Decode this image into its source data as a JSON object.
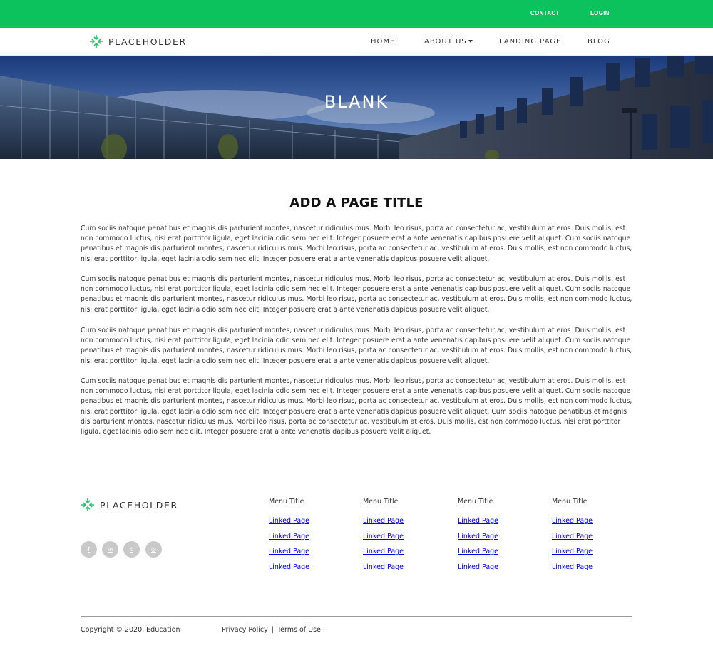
{
  "topbar": {
    "contact_label": "CONTACT",
    "login_label": "LOGIN",
    "background_color": "#0cc25c"
  },
  "header": {
    "logo_text": "PLACEHOLDER",
    "nav": {
      "home": "HOME",
      "about": "ABOUT US",
      "landing": "LANDING PAGE",
      "blog": "BLOG"
    }
  },
  "hero": {
    "title": "BLANK"
  },
  "main": {
    "page_title": "ADD A PAGE TITLE",
    "paragraphs": [
      "Cum sociis natoque penatibus et magnis dis parturient montes, nascetur ridiculus mus. Morbi leo risus, porta ac consectetur ac, vestibulum at eros. Duis mollis, est non commodo luctus, nisi erat porttitor ligula, eget lacinia odio sem nec elit. Integer posuere erat a ante venenatis dapibus posuere velit aliquet. Cum sociis natoque penatibus et magnis dis parturient montes, nascetur ridiculus mus. Morbi leo risus, porta ac consectetur ac, vestibulum at eros. Duis mollis, est non commodo luctus, nisi erat porttitor ligula, eget lacinia odio sem nec elit. Integer posuere erat a ante venenatis dapibus posuere velit aliquet.",
      "Cum sociis natoque penatibus et magnis dis parturient montes, nascetur ridiculus mus. Morbi leo risus, porta ac consectetur ac, vestibulum at eros. Duis mollis, est non commodo luctus, nisi erat porttitor ligula, eget lacinia odio sem nec elit. Integer posuere erat a ante venenatis dapibus posuere velit aliquet. Cum sociis natoque penatibus et magnis dis parturient montes, nascetur ridiculus mus. Morbi leo risus, porta ac consectetur ac, vestibulum at eros. Duis mollis, est non commodo luctus, nisi erat porttitor ligula, eget lacinia odio sem nec elit. Integer posuere erat a ante venenatis dapibus posuere velit aliquet.",
      "Cum sociis natoque penatibus et magnis dis parturient montes, nascetur ridiculus mus. Morbi leo risus, porta ac consectetur ac, vestibulum at eros. Duis mollis, est non commodo luctus, nisi erat porttitor ligula, eget lacinia odio sem nec elit. Integer posuere erat a ante venenatis dapibus posuere velit aliquet. Cum sociis natoque penatibus et magnis dis parturient montes, nascetur ridiculus mus. Morbi leo risus, porta ac consectetur ac, vestibulum at eros. Duis mollis, est non commodo luctus, nisi erat porttitor ligula, eget lacinia odio sem nec elit. Integer posuere erat a ante venenatis dapibus posuere velit aliquet.",
      "Cum sociis natoque penatibus et magnis dis parturient montes, nascetur ridiculus mus. Morbi leo risus, porta ac consectetur ac, vestibulum at eros. Duis mollis, est non commodo luctus, nisi erat porttitor ligula, eget lacinia odio sem nec elit. Integer posuere erat a ante venenatis dapibus posuere velit aliquet. Cum sociis natoque penatibus et magnis dis parturient montes, nascetur ridiculus mus. Morbi leo risus, porta ac consectetur ac, vestibulum at eros. Duis mollis, est non commodo luctus, nisi erat porttitor ligula, eget lacinia odio sem nec elit. Integer posuere erat a ante venenatis dapibus posuere velit aliquet. Cum sociis natoque penatibus et magnis dis parturient montes, nascetur ridiculus mus. Morbi leo risus, porta ac consectetur ac, vestibulum at eros. Duis mollis, est non commodo luctus, nisi erat porttitor ligula, eget lacinia odio sem nec elit. Integer posuere erat a ante venenatis dapibus posuere velit aliquet."
    ]
  },
  "footer": {
    "logo_text": "PLACEHOLDER",
    "social": [
      {
        "icon": "facebook-icon",
        "glyph": "f"
      },
      {
        "icon": "linkedin-icon",
        "glyph": "in"
      },
      {
        "icon": "twitter-icon",
        "glyph": "t"
      },
      {
        "icon": "instagram-icon",
        "glyph": "◎"
      }
    ],
    "columns": [
      {
        "title": "Menu Title",
        "links": [
          "Linked Page",
          "Linked Page",
          "Linked Page",
          "Linked Page"
        ]
      },
      {
        "title": "Menu Title",
        "links": [
          "Linked Page",
          "Linked Page",
          "Linked Page",
          "Linked Page"
        ]
      },
      {
        "title": "Menu Title",
        "links": [
          "Linked Page",
          "Linked Page",
          "Linked Page",
          "Linked Page"
        ]
      },
      {
        "title": "Menu Title",
        "links": [
          "Linked Page",
          "Linked Page",
          "Linked Page",
          "Linked Page"
        ]
      }
    ],
    "copyright": "Copyright © 2020, Education",
    "privacy": "Privacy Policy",
    "separator": "|",
    "terms": "Terms of Use"
  },
  "colors": {
    "accent": "#0cc25c",
    "social_bg": "#c9c9c9"
  }
}
